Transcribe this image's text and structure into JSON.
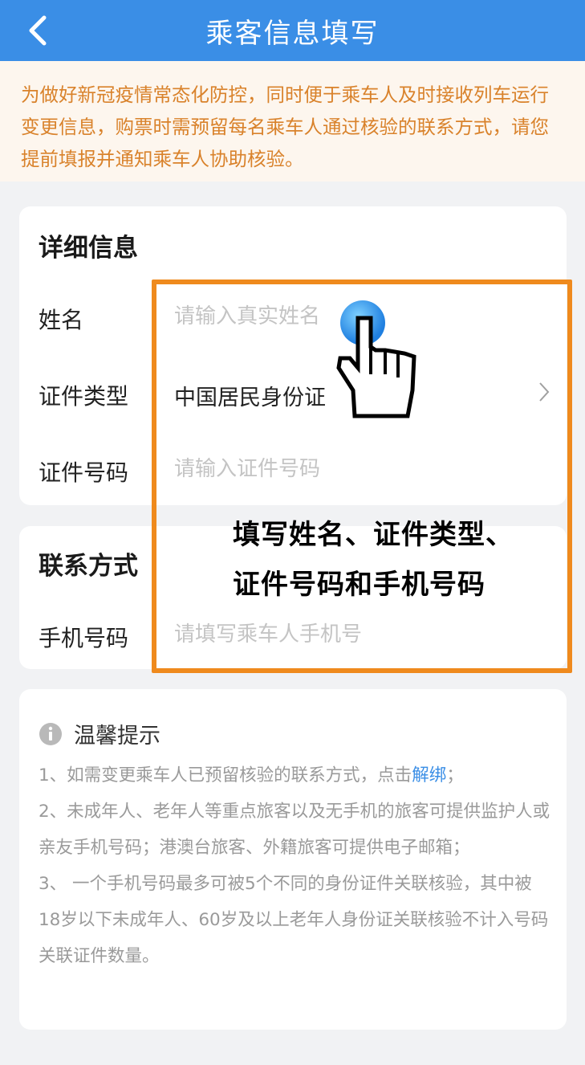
{
  "header": {
    "title": "乘客信息填写",
    "back_icon": "chevron-left-icon"
  },
  "notice": {
    "text": "为做好新冠疫情常态化防控，同时便于乘车人及时接收列车运行变更信息，购票时需预留每名乘车人通过核验的联系方式，请您提前填报并通知乘车人协助核验。"
  },
  "details": {
    "title": "详细信息",
    "name_label": "姓名",
    "name_placeholder": "请输入真实姓名",
    "id_type_label": "证件类型",
    "id_type_value": "中国居民身份证",
    "id_number_label": "证件号码",
    "id_number_placeholder": "请输入证件号码"
  },
  "contact": {
    "title": "联系方式",
    "phone_label": "手机号码",
    "phone_placeholder": "请填写乘车人手机号"
  },
  "annotation": {
    "line1": "填写姓名、证件类型、",
    "line2": "证件号码和手机号码"
  },
  "tips": {
    "title": "温馨提示",
    "item1_prefix": "1、如需变更乘车人已预留核验的联系方式，点击",
    "item1_link": "解绑",
    "item1_suffix": "；",
    "item2": "2、未成年人、老年人等重点旅客以及无手机的旅客可提供监护人或亲友手机号码；港澳台旅客、外籍旅客可提供电子邮箱；",
    "item3": "3、 一个手机号码最多可被5个不同的身份证件关联核验，其中被18岁以下未成年人、60岁及以上老年人身份证关联核验不计入号码关联证件数量。"
  },
  "colors": {
    "header": "#3a8ee6",
    "notice_text": "#d9822b",
    "highlight": "#ef8a1d",
    "link": "#3a8ee6"
  }
}
